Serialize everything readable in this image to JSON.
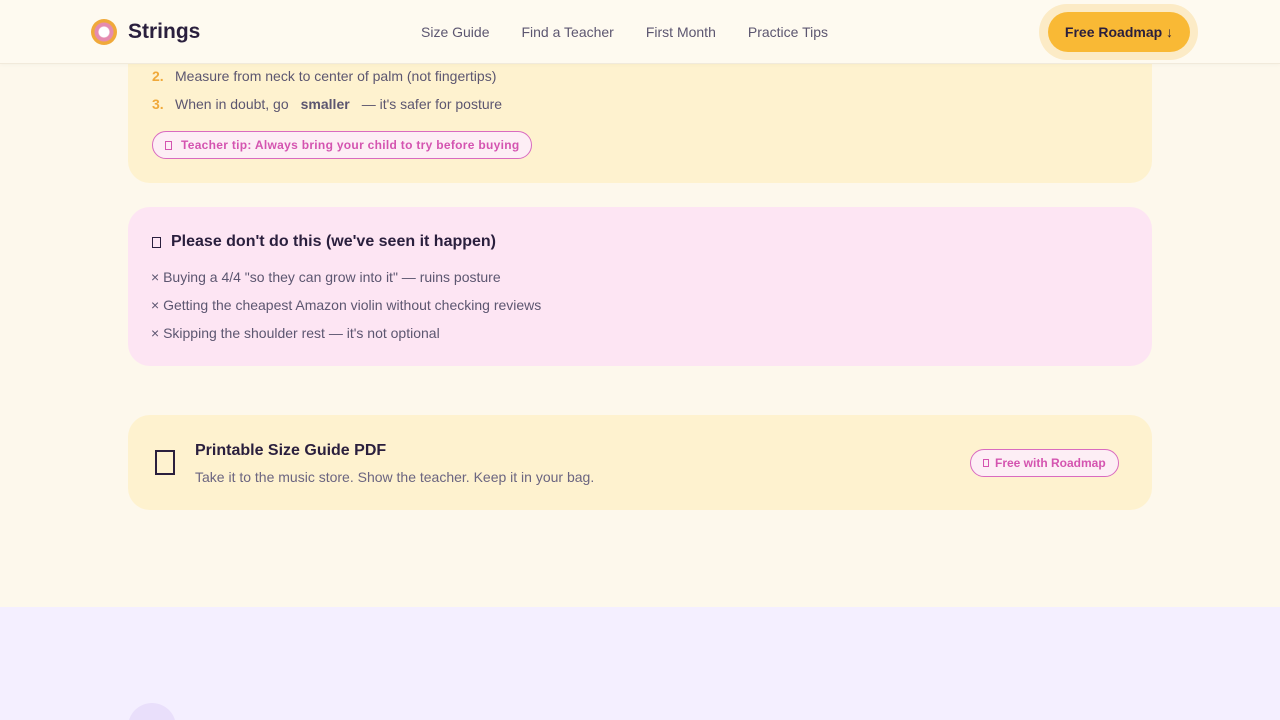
{
  "nav": {
    "brand": "Strings",
    "links": [
      "Size Guide",
      "Find a Teacher",
      "First Month",
      "Practice Tips"
    ],
    "cta": "Free Roadmap ↓"
  },
  "steps": [
    {
      "num": "2.",
      "text": "Measure from neck to center of palm (not fingertips)"
    },
    {
      "num": "3.",
      "pre": "When in doubt, go",
      "bold": "smaller",
      "post": "— it's safer for posture"
    }
  ],
  "tip": "Teacher tip: Always bring your child to try before buying",
  "warning": {
    "title": "Please don't do this (we've seen it happen)",
    "items": [
      "× Buying a 4/4 \"so they can grow into it\" — ruins posture",
      "× Getting the cheapest Amazon violin without checking reviews",
      "× Skipping the shoulder rest — it's not optional"
    ]
  },
  "pdf": {
    "title": "Printable Size Guide PDF",
    "subtitle": "Take it to the music store. Show the teacher. Keep it in your bag.",
    "badge": "Free with Roadmap"
  },
  "icons": {
    "logo": "violin-flower-logo",
    "tip": "lightbulb-icon",
    "warning": "warning-icon",
    "pdf": "document-icon",
    "badge": "gift-icon"
  },
  "colors": {
    "accent": "#f9b935",
    "pink": "#d454b0",
    "card_yellow": "#fef2cf",
    "card_pink": "#fde5f3"
  }
}
